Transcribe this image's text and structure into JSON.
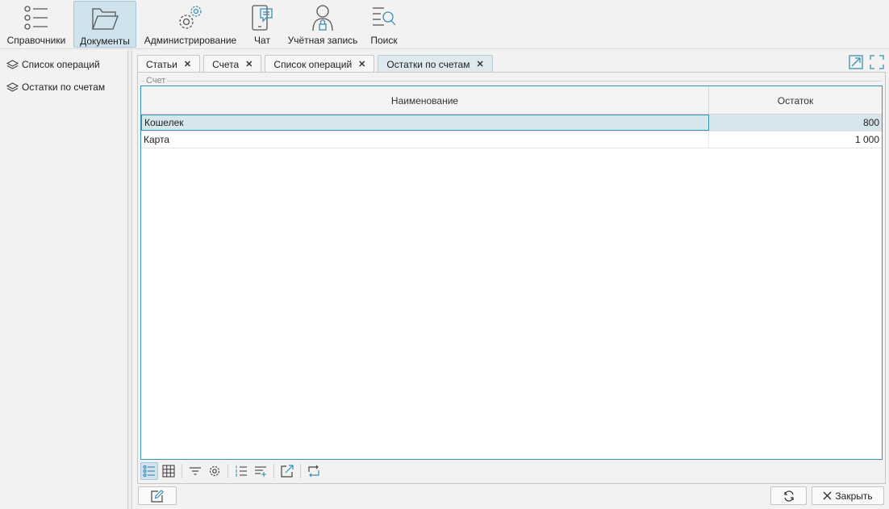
{
  "nav": [
    {
      "id": "refs",
      "label": "Справочники",
      "icon": "list-icon",
      "active": false
    },
    {
      "id": "docs",
      "label": "Документы",
      "icon": "folder-icon",
      "active": true
    },
    {
      "id": "admin",
      "label": "Администрирование",
      "icon": "gears-icon",
      "active": false
    },
    {
      "id": "chat",
      "label": "Чат",
      "icon": "chat-phone-icon",
      "active": false
    },
    {
      "id": "account",
      "label": "Учётная запись",
      "icon": "user-lock-icon",
      "active": false
    },
    {
      "id": "search",
      "label": "Поиск",
      "icon": "search-list-icon",
      "active": false
    }
  ],
  "sidebar": {
    "items": [
      {
        "label": "Список операций",
        "icon": "layers-icon"
      },
      {
        "label": "Остатки по счетам",
        "icon": "layers-icon"
      }
    ]
  },
  "tabs": [
    {
      "label": "Статьи",
      "active": false
    },
    {
      "label": "Счета",
      "active": false
    },
    {
      "label": "Список операций",
      "active": false
    },
    {
      "label": "Остатки по счетам",
      "active": true
    }
  ],
  "tab_close_glyph": "✕",
  "panel": {
    "group_label": "Счет",
    "columns": [
      "Наименование",
      "Остаток"
    ],
    "rows": [
      {
        "name": "Кошелек",
        "balance": "800",
        "selected": true
      },
      {
        "name": "Карта",
        "balance": "1 000",
        "selected": false
      }
    ]
  },
  "buttons": {
    "close_label": "Закрыть"
  },
  "colors": {
    "accent": "#3a8fb4",
    "selection": "#d5e6ec",
    "active_nav": "#cfe3ec"
  }
}
